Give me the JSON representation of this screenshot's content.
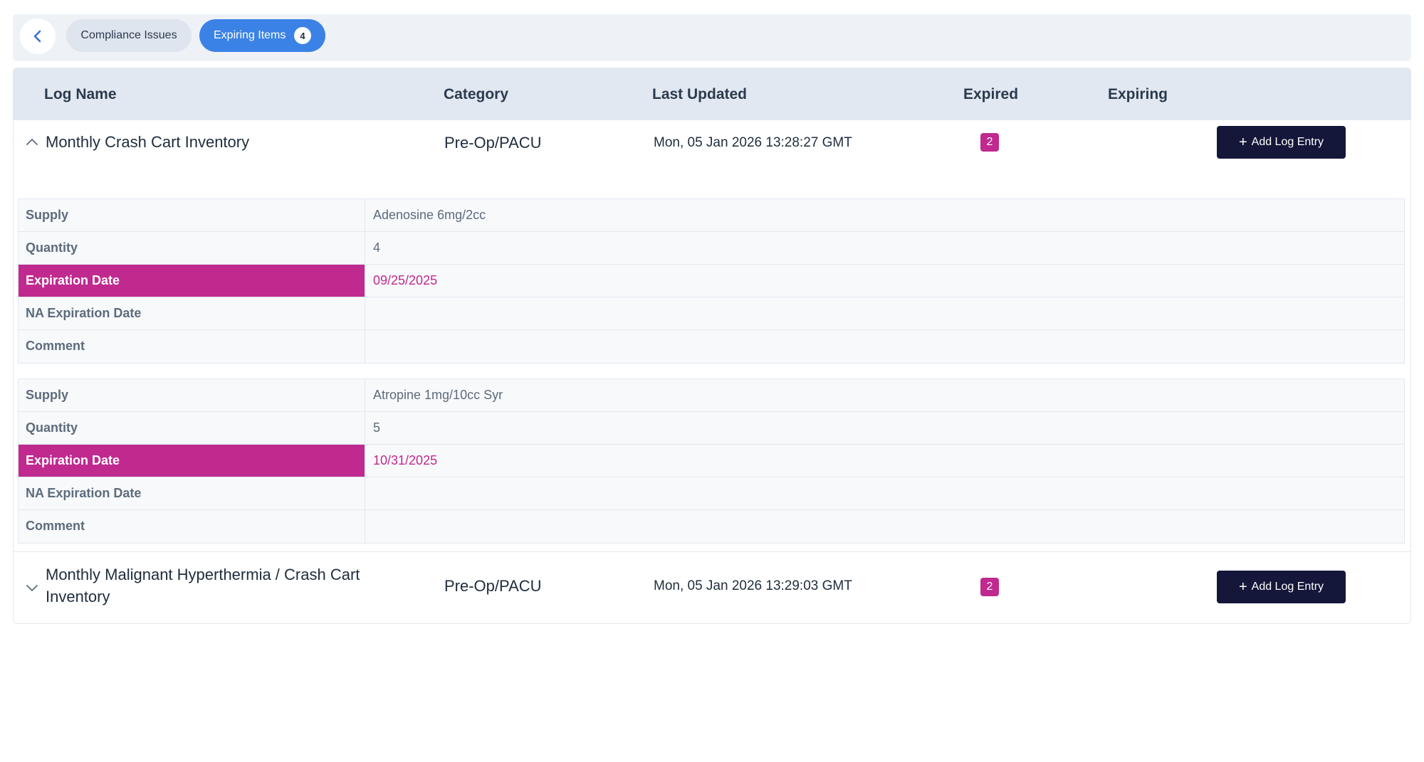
{
  "tabs": {
    "compliance_label": "Compliance Issues",
    "expiring_label": "Expiring Items",
    "expiring_count": "4"
  },
  "table": {
    "headers": {
      "log_name": "Log Name",
      "category": "Category",
      "last_updated": "Last Updated",
      "expired": "Expired",
      "expiring": "Expiring"
    },
    "rows": [
      {
        "name": "Monthly Crash Cart Inventory",
        "category": "Pre-Op/PACU",
        "last_updated": "Mon, 05 Jan 2026 13:28:27 GMT",
        "expired": "2",
        "action_label": "Add Log Entry",
        "expanded": true,
        "items": [
          {
            "supply_label": "Supply",
            "supply": "Adenosine 6mg/2cc",
            "quantity_label": "Quantity",
            "quantity": "4",
            "expiration_label": "Expiration Date",
            "expiration": "09/25/2025",
            "na_expiration_label": "NA Expiration Date",
            "na_expiration": "",
            "comment_label": "Comment",
            "comment": ""
          },
          {
            "supply_label": "Supply",
            "supply": "Atropine 1mg/10cc Syr",
            "quantity_label": "Quantity",
            "quantity": "5",
            "expiration_label": "Expiration Date",
            "expiration": "10/31/2025",
            "na_expiration_label": "NA Expiration Date",
            "na_expiration": "",
            "comment_label": "Comment",
            "comment": ""
          }
        ]
      },
      {
        "name_line1": "Monthly Malignant Hyperthermia / Crash Cart",
        "name_line2": "Inventory",
        "category": "Pre-Op/PACU",
        "last_updated": "Mon, 05 Jan 2026 13:29:03 GMT",
        "expired": "2",
        "action_label": "Add Log Entry",
        "expanded": false
      }
    ]
  },
  "colors": {
    "accent_blue": "#3b82e6",
    "expired_magenta": "#c0298e",
    "button_navy": "#14163a",
    "header_bg": "#e2e8f1"
  }
}
